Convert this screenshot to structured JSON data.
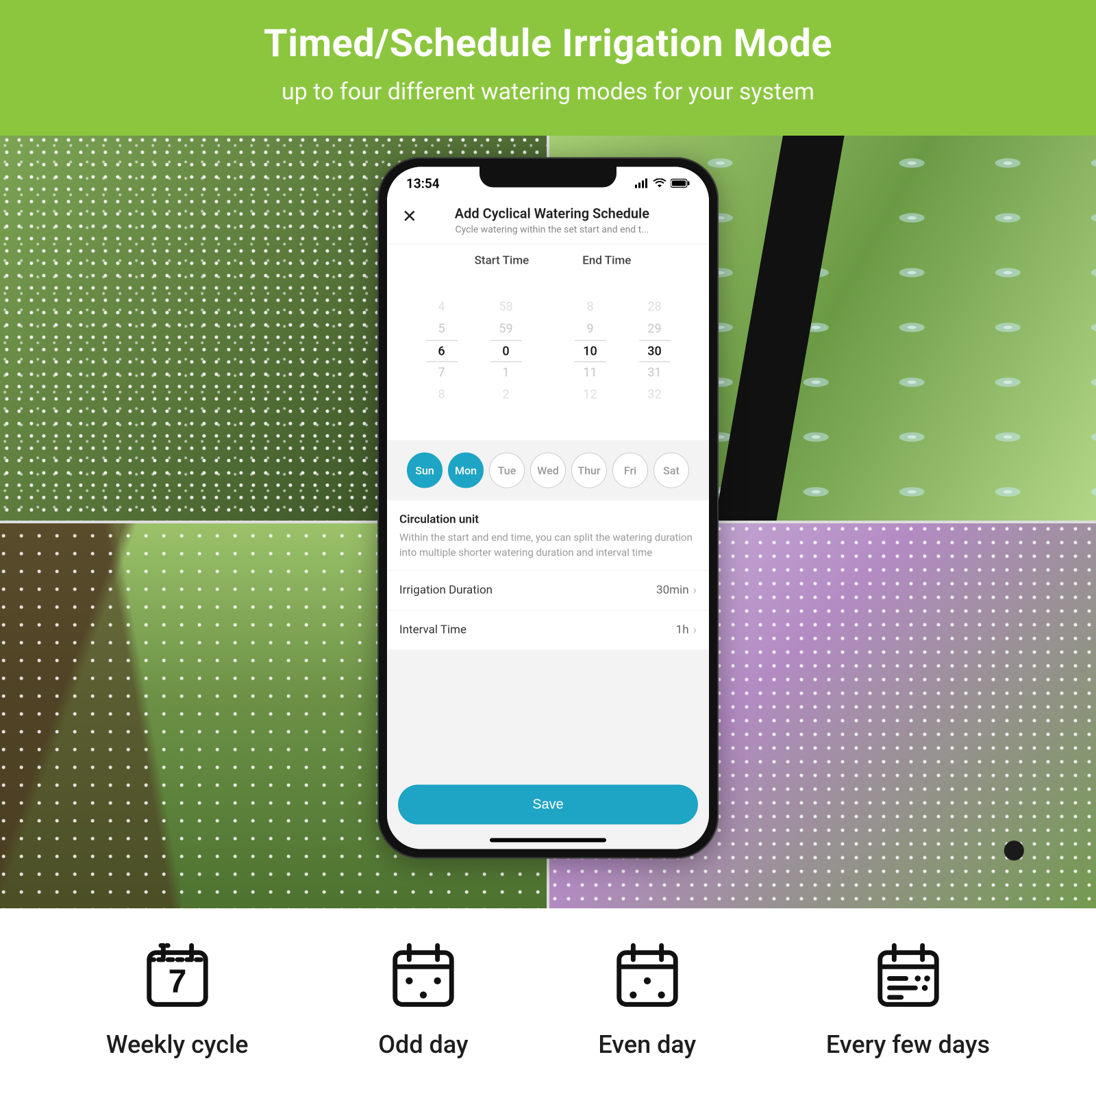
{
  "banner": {
    "title": "Timed/Schedule Irrigation Mode",
    "subtitle": "up to four different watering modes for your system"
  },
  "status": {
    "time": "13:54"
  },
  "header": {
    "title": "Add Cyclical Watering Schedule",
    "subtitle": "Cycle watering within the set start and end t..."
  },
  "time_section": {
    "start_label": "Start Time",
    "end_label": "End Time",
    "start_hour": {
      "r0": "",
      "r1": "4",
      "r2": "5",
      "sel": "6",
      "r4": "7",
      "r5": "8",
      "r6": ""
    },
    "start_min": {
      "r0": "",
      "r1": "58",
      "r2": "59",
      "sel": "0",
      "r4": "1",
      "r5": "2",
      "r6": ""
    },
    "end_hour": {
      "r0": "",
      "r1": "8",
      "r2": "9",
      "sel": "10",
      "r4": "11",
      "r5": "12",
      "r6": ""
    },
    "end_min": {
      "r0": "",
      "r1": "28",
      "r2": "29",
      "sel": "30",
      "r4": "31",
      "r5": "32",
      "r6": ""
    }
  },
  "days": {
    "sun": "Sun",
    "mon": "Mon",
    "tue": "Tue",
    "wed": "Wed",
    "thur": "Thur",
    "fri": "Fri",
    "sat": "Sat"
  },
  "circulation": {
    "title": "Circulation unit",
    "desc": "Within the start and end time, you can split the watering duration into multiple shorter watering duration and interval time"
  },
  "settings": {
    "irrigation_label": "Irrigation Duration",
    "irrigation_value": "30min",
    "interval_label": "Interval Time",
    "interval_value": "1h"
  },
  "save_label": "Save",
  "modes": {
    "weekly": "Weekly cycle",
    "odd": "Odd day",
    "even": "Even day",
    "few": "Every few days"
  }
}
